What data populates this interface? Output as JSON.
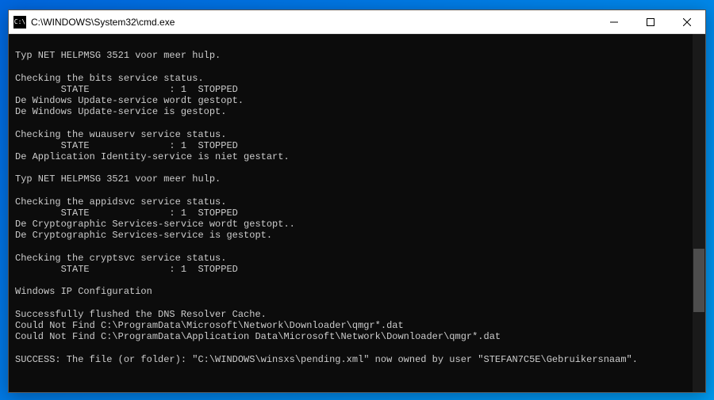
{
  "window": {
    "title": "C:\\WINDOWS\\System32\\cmd.exe",
    "icon_label": "cmd-icon"
  },
  "controls": {
    "minimize": "—",
    "maximize": "☐",
    "close": "✕"
  },
  "terminal": {
    "lines": [
      "",
      "Typ NET HELPMSG 3521 voor meer hulp.",
      "",
      "Checking the bits service status.",
      "        STATE              : 1  STOPPED",
      "De Windows Update-service wordt gestopt.",
      "De Windows Update-service is gestopt.",
      "",
      "Checking the wuauserv service status.",
      "        STATE              : 1  STOPPED",
      "De Application Identity-service is niet gestart.",
      "",
      "Typ NET HELPMSG 3521 voor meer hulp.",
      "",
      "Checking the appidsvc service status.",
      "        STATE              : 1  STOPPED",
      "De Cryptographic Services-service wordt gestopt..",
      "De Cryptographic Services-service is gestopt.",
      "",
      "Checking the cryptsvc service status.",
      "        STATE              : 1  STOPPED",
      "",
      "Windows IP Configuration",
      "",
      "Successfully flushed the DNS Resolver Cache.",
      "Could Not Find C:\\ProgramData\\Microsoft\\Network\\Downloader\\qmgr*.dat",
      "Could Not Find C:\\ProgramData\\Application Data\\Microsoft\\Network\\Downloader\\qmgr*.dat",
      "",
      "SUCCESS: The file (or folder): \"C:\\WINDOWS\\winsxs\\pending.xml\" now owned by user \"STEFAN7C5E\\Gebruikersnaam\"."
    ]
  }
}
